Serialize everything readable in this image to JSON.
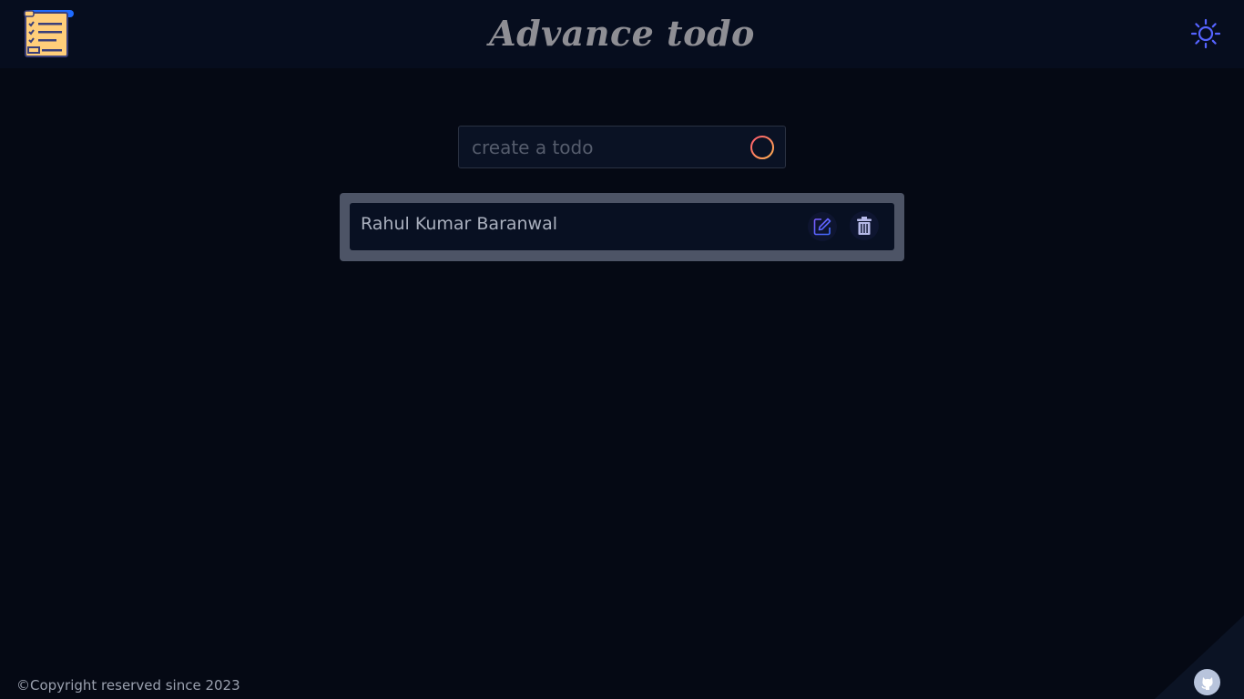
{
  "header": {
    "title": "Advance todo",
    "logo_icon": "checklist-icon",
    "theme_icon": "sun-icon"
  },
  "create": {
    "placeholder": "create a todo",
    "value": "",
    "add_icon": "plus-circle-icon"
  },
  "todos": [
    {
      "text": "Rahul Kumar Baranwal",
      "edit_icon": "edit-icon",
      "delete_icon": "trash-icon"
    }
  ],
  "footer": {
    "copyright": "©Copyright reserved since 2023",
    "github_icon": "github-icon"
  },
  "colors": {
    "background": "#050914",
    "header": "#060d1e",
    "accent": "#4b5bff",
    "add_gradient_start": "#ff5a6e",
    "add_gradient_end": "#ffb050"
  }
}
